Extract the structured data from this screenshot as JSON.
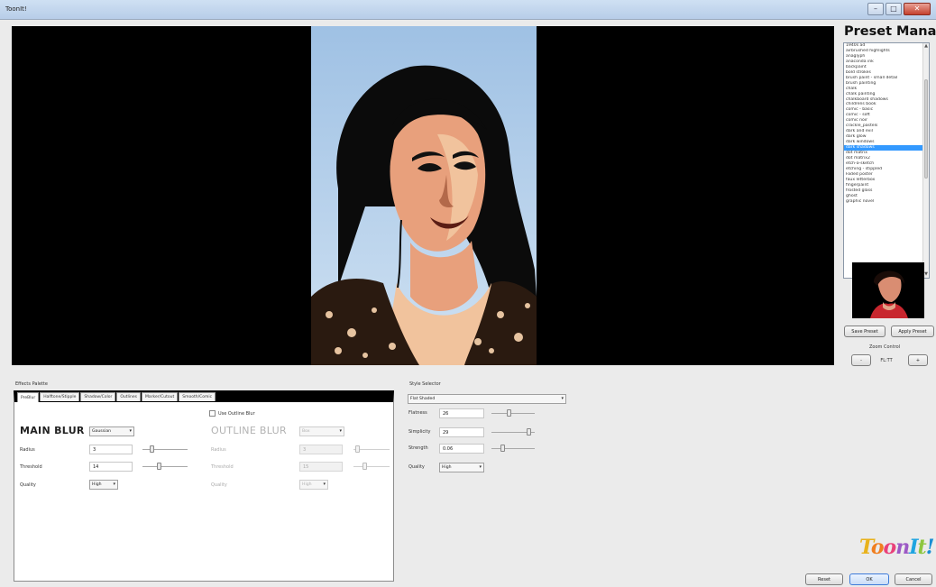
{
  "window": {
    "title": "ToonIt!"
  },
  "preset_manager": {
    "title": "Preset Manager",
    "items": [
      "1940s ad",
      "airbrushed highlights",
      "anaglyph",
      "anaconda ink",
      "backpaint",
      "bold strokes",
      "brush paint - small detail",
      "brush painting",
      "chalk",
      "chalk painting",
      "chalkboard shadows",
      "childrens book",
      "comic - basic",
      "comic - soft",
      "comic noir",
      "crackle_pastels",
      "dark and evil",
      "dark glow",
      "dark windows",
      "dark shadows",
      "dot matrix",
      "dot matrix2",
      "etch-a-sketch",
      "etching - stippled",
      "Faded poster",
      "faux letterbox",
      "fingerpaint",
      "frosted glass",
      "ghost",
      "graphic novel"
    ],
    "selected": "dark shadows",
    "save_label": "Save Preset",
    "apply_label": "Apply Preset",
    "zoom_label": "Zoom Control",
    "zoom_value": "FL:TT",
    "zoom_out_label": "-",
    "zoom_in_label": "+"
  },
  "effects_palette": {
    "label": "Effects Palette",
    "tabs": [
      "PreBlur",
      "Halftone/Stipple",
      "Shadow/Color",
      "Outlines",
      "Marker/Cutout",
      "Smooth/Comic"
    ],
    "active_tab": "PreBlur",
    "use_outline_blur_label": "Use Outline Blur",
    "main_blur": {
      "heading": "MAIN BLUR",
      "type": "Gaussian",
      "radius_label": "Radius",
      "radius": "3",
      "threshold_label": "Threshold",
      "threshold": "14",
      "quality_label": "Quality",
      "quality": "High"
    },
    "outline_blur": {
      "heading": "OUTLINE BLUR",
      "type": "Box",
      "radius_label": "Radius",
      "radius": "3",
      "threshold_label": "Threshold",
      "threshold": "15",
      "quality_label": "Quality",
      "quality": "High"
    }
  },
  "style_selector": {
    "label": "Style Selector",
    "value": "Flat Shaded",
    "flatness_label": "Flatness",
    "flatness": "26",
    "simplicity_label": "Simplicity",
    "simplicity": "29",
    "strength_label": "Strength",
    "strength": "0.06",
    "quality_label": "Quality",
    "quality": "High"
  },
  "sliders": {
    "main_radius": 0.2,
    "main_threshold": 0.35,
    "outline_radius": 0.1,
    "outline_threshold": 0.3,
    "flatness": 0.4,
    "simplicity": 0.85,
    "strength": 0.25
  },
  "footer": {
    "logo_text": "ToonIt!",
    "reset_label": "Reset",
    "ok_label": "OK",
    "cancel_label": "Cancel"
  },
  "colors": {
    "accent": "#3399ff",
    "viewer_bg": "#000000"
  }
}
